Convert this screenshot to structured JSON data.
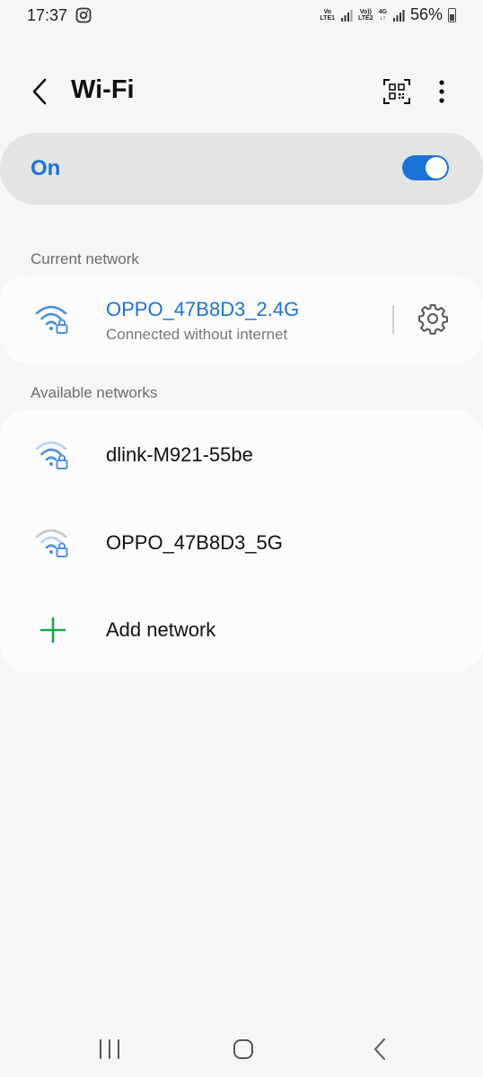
{
  "status_bar": {
    "time": "17:37",
    "sim1_top": "Vo",
    "sim1_bottom": "LTE1",
    "sim2_top": "Vo))",
    "sim2_bottom": "LTE2",
    "net_type": "4G",
    "battery": "56%"
  },
  "header": {
    "title": "Wi-Fi"
  },
  "wifi_toggle": {
    "label": "On",
    "enabled": true
  },
  "current_network": {
    "section_label": "Current network",
    "name": "OPPO_47B8D3_2.4G",
    "status": "Connected without internet"
  },
  "available_networks": {
    "section_label": "Available networks",
    "items": [
      {
        "name": "dlink-M921-55be"
      },
      {
        "name": "OPPO_47B8D3_5G"
      }
    ],
    "add_label": "Add network"
  },
  "colors": {
    "accent": "#1a73d9",
    "add_green": "#1aa64b",
    "wifi_icon": "#4a90e2"
  }
}
